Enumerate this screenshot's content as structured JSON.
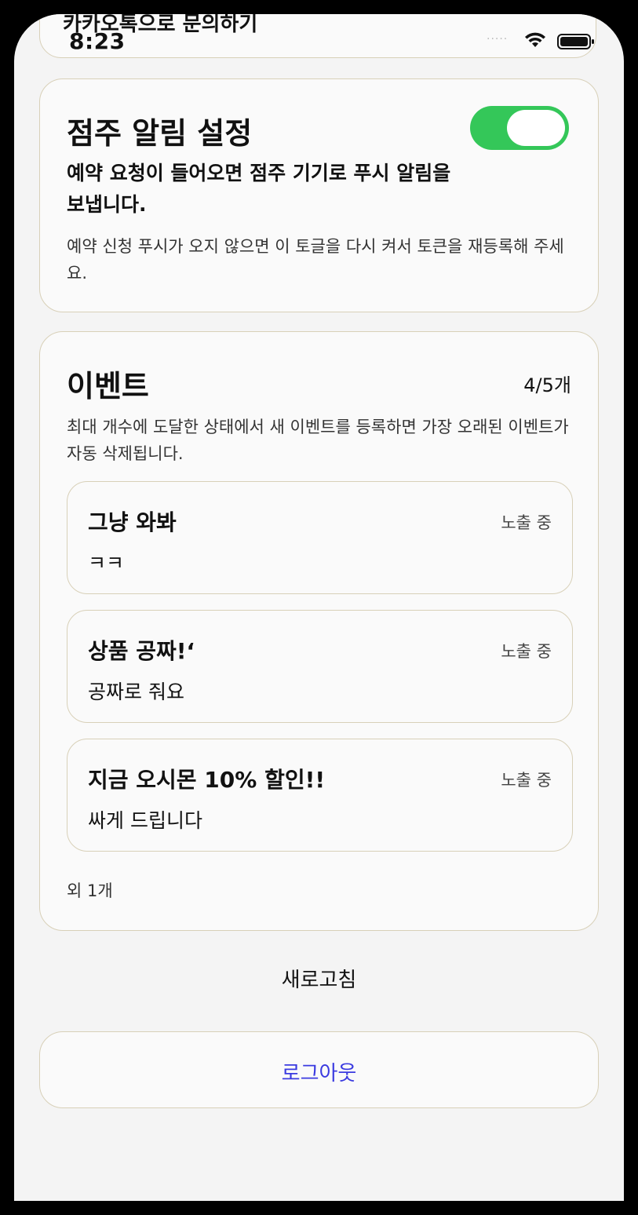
{
  "status_bar": {
    "time": "8:23",
    "signal_dots": "·····"
  },
  "top_card": {
    "label": "카카오톡으로 문의하기"
  },
  "notification": {
    "title": "점주 알림 설정",
    "description": "예약 요청이 들어오면 점주 기기로 푸시 알림을 보냅니다.",
    "note": "예약 신청 푸시가 오지 않으면 이 토글을 다시 켜서 토큰을 재등록해 주세요.",
    "toggle_on": true,
    "toggle_color": "#34c759"
  },
  "events": {
    "title": "이벤트",
    "count": "4/5개",
    "description": "최대 개수에 도달한 상태에서 새 이벤트를 등록하면 가장 오래된 이벤트가 자동 삭제됩니다.",
    "items": [
      {
        "title": "그냥 와봐",
        "body": "ㅋㅋ",
        "status": "노출 중"
      },
      {
        "title": "상품 공짜!‘",
        "body": "공짜로 줘요",
        "status": "노출 중"
      },
      {
        "title": "지금 오시몬 10% 할인!!",
        "body": "싸게 드립니다",
        "status": "노출 중"
      }
    ],
    "more": "외 1개"
  },
  "actions": {
    "refresh_label": "새로고침",
    "logout_label": "로그아웃",
    "logout_color": "#3a3ae0"
  }
}
